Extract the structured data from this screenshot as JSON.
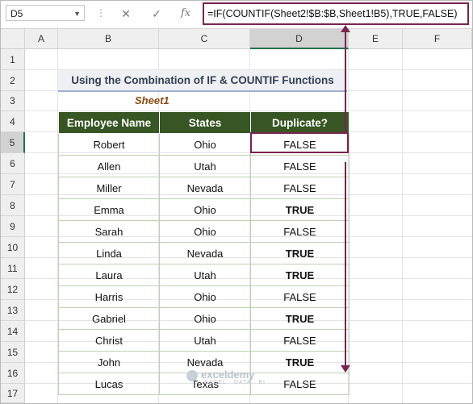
{
  "formula_bar": {
    "name_box": "D5",
    "cancel_symbol": "✕",
    "enter_symbol": "✓",
    "fx_label": "fx",
    "formula": "=IF(COUNTIF(Sheet2!$B:$B,Sheet1!B5),TRUE,FALSE)"
  },
  "columns": [
    "A",
    "B",
    "C",
    "D",
    "E",
    "F"
  ],
  "rows": [
    "1",
    "2",
    "3",
    "4",
    "5",
    "6",
    "7",
    "8",
    "9",
    "10",
    "11",
    "12",
    "13",
    "14",
    "15",
    "16",
    "17"
  ],
  "title": "Using the Combination of IF & COUNTIF Functions",
  "sheet_label": "Sheet1",
  "table": {
    "headers": [
      "Employee Name",
      "States",
      "Duplicate?"
    ],
    "rows": [
      [
        "Robert",
        "Ohio",
        "FALSE"
      ],
      [
        "Allen",
        "Utah",
        "FALSE"
      ],
      [
        "Miller",
        "Nevada",
        "FALSE"
      ],
      [
        "Emma",
        "Ohio",
        "TRUE"
      ],
      [
        "Sarah",
        "Ohio",
        "FALSE"
      ],
      [
        "Linda",
        "Nevada",
        "TRUE"
      ],
      [
        "Laura",
        "Utah",
        "TRUE"
      ],
      [
        "Harris",
        "Ohio",
        "FALSE"
      ],
      [
        "Gabriel",
        "Ohio",
        "TRUE"
      ],
      [
        "Christ",
        "Utah",
        "FALSE"
      ],
      [
        "John",
        "Nevada",
        "TRUE"
      ],
      [
        "Lucas",
        "Texas",
        "FALSE"
      ]
    ]
  },
  "colors": {
    "header_fill": "#375623",
    "highlight": "#7b2350",
    "true_text": "#8b4513"
  },
  "watermark": {
    "name": "exceldemy",
    "tagline": "EXCEL · DATA · BI"
  }
}
